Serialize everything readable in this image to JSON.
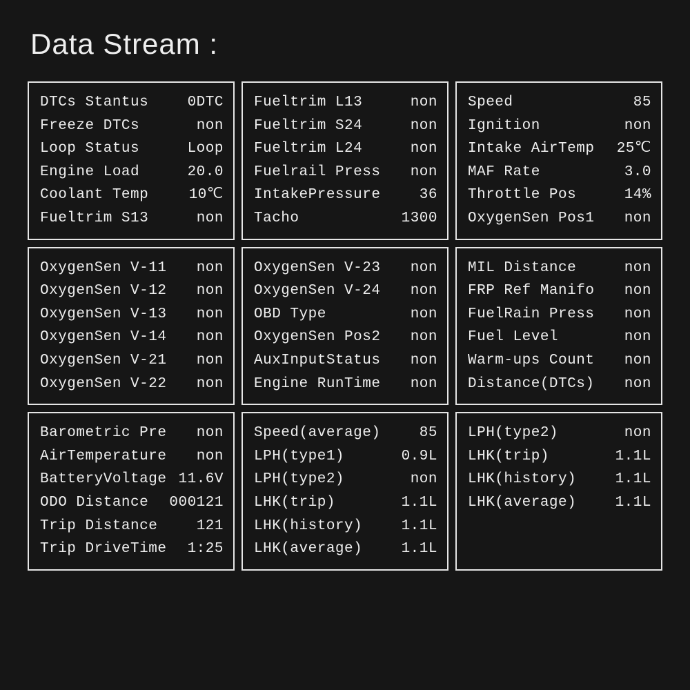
{
  "title": "Data Stream :",
  "panels": [
    {
      "rows": [
        {
          "label": "DTCs Stantus",
          "value": "0DTC"
        },
        {
          "label": "Freeze DTCs",
          "value": "non"
        },
        {
          "label": "Loop Status",
          "value": "Loop"
        },
        {
          "label": "Engine Load",
          "value": "20.0"
        },
        {
          "label": "Coolant Temp",
          "value": "10℃"
        },
        {
          "label": "Fueltrim S13",
          "value": "non"
        }
      ]
    },
    {
      "rows": [
        {
          "label": "Fueltrim L13",
          "value": "non"
        },
        {
          "label": "Fueltrim S24",
          "value": "non"
        },
        {
          "label": "Fueltrim L24",
          "value": "non"
        },
        {
          "label": "Fuelrail Press",
          "value": "non"
        },
        {
          "label": "IntakePressure",
          "value": "36"
        },
        {
          "label": "Tacho",
          "value": "1300"
        }
      ]
    },
    {
      "rows": [
        {
          "label": "Speed",
          "value": "85"
        },
        {
          "label": "Ignition",
          "value": "non"
        },
        {
          "label": "Intake AirTemp",
          "value": "25℃"
        },
        {
          "label": "MAF Rate",
          "value": "3.0"
        },
        {
          "label": "Throttle Pos",
          "value": "14%"
        },
        {
          "label": "OxygenSen Pos1",
          "value": "non"
        }
      ]
    },
    {
      "rows": [
        {
          "label": "OxygenSen V-11",
          "value": "non"
        },
        {
          "label": "OxygenSen V-12",
          "value": "non"
        },
        {
          "label": "OxygenSen V-13",
          "value": "non"
        },
        {
          "label": "OxygenSen V-14",
          "value": "non"
        },
        {
          "label": "OxygenSen V-21",
          "value": "non"
        },
        {
          "label": "OxygenSen V-22",
          "value": "non"
        }
      ]
    },
    {
      "rows": [
        {
          "label": "OxygenSen V-23",
          "value": "non"
        },
        {
          "label": "OxygenSen V-24",
          "value": "non"
        },
        {
          "label": "OBD Type",
          "value": "non"
        },
        {
          "label": "OxygenSen Pos2",
          "value": "non"
        },
        {
          "label": "AuxInputStatus",
          "value": "non"
        },
        {
          "label": "Engine RunTime",
          "value": "non"
        }
      ]
    },
    {
      "rows": [
        {
          "label": "MIL  Distance",
          "value": "non"
        },
        {
          "label": "FRP Ref Manifo",
          "value": "non"
        },
        {
          "label": "FuelRain Press",
          "value": "non"
        },
        {
          "label": "Fuel Level",
          "value": "non"
        },
        {
          "label": "Warm-ups Count",
          "value": "non"
        },
        {
          "label": "Distance(DTCs)",
          "value": "non"
        }
      ]
    },
    {
      "rows": [
        {
          "label": "Barometric Pre",
          "value": "non"
        },
        {
          "label": "AirTemperature",
          "value": "non"
        },
        {
          "label": "BatteryVoltage",
          "value": "11.6V"
        },
        {
          "label": "ODO Distance",
          "value": "000121"
        },
        {
          "label": "Trip Distance",
          "value": "121"
        },
        {
          "label": "Trip DriveTime",
          "value": "1:25"
        }
      ]
    },
    {
      "rows": [
        {
          "label": "Speed(average)",
          "value": "85"
        },
        {
          "label": "LPH(type1)",
          "value": "0.9L"
        },
        {
          "label": "LPH(type2)",
          "value": "non"
        },
        {
          "label": "LHK(trip)",
          "value": "1.1L"
        },
        {
          "label": "LHK(history)",
          "value": "1.1L"
        },
        {
          "label": "LHK(average)",
          "value": "1.1L"
        }
      ]
    },
    {
      "rows": [
        {
          "label": "LPH(type2)",
          "value": "non"
        },
        {
          "label": "LHK(trip)",
          "value": "1.1L"
        },
        {
          "label": "LHK(history)",
          "value": "1.1L"
        },
        {
          "label": "LHK(average)",
          "value": "1.1L"
        }
      ]
    }
  ]
}
